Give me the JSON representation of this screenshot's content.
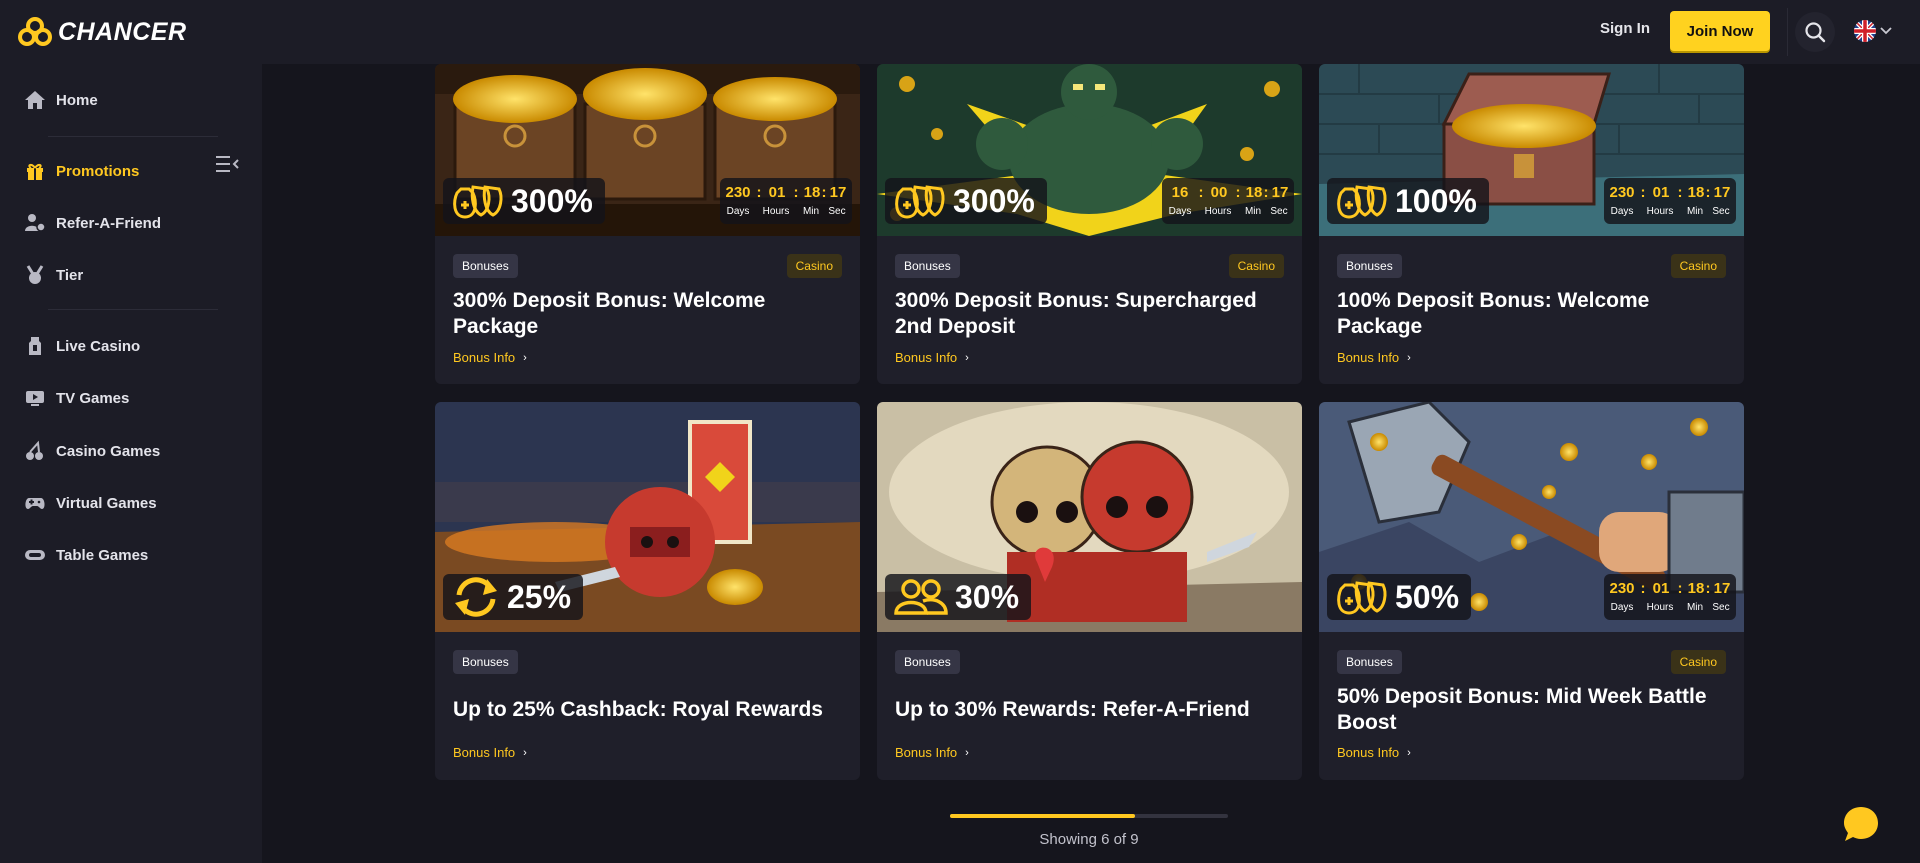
{
  "header": {
    "logo_text": "CHANCER",
    "sign_in": "Sign In",
    "join_now": "Join Now",
    "icons": [
      "logo-icon",
      "search-icon",
      "uk-flag-icon",
      "chevron-down-icon"
    ]
  },
  "sidebar": {
    "items": [
      {
        "label": "Home",
        "icon": "home-icon",
        "active": false
      },
      {
        "label": "Promotions",
        "icon": "gift-icon",
        "active": true
      },
      {
        "label": "Refer-A-Friend",
        "icon": "refer-friend-icon",
        "active": false
      },
      {
        "label": "Tier",
        "icon": "medal-icon",
        "active": false
      },
      {
        "label": "Live Casino",
        "icon": "live-casino-icon",
        "active": false
      },
      {
        "label": "TV Games",
        "icon": "tv-icon",
        "active": false
      },
      {
        "label": "Casino Games",
        "icon": "cherries-icon",
        "active": false
      },
      {
        "label": "Virtual Games",
        "icon": "gamepad-icon",
        "active": false
      },
      {
        "label": "Table Games",
        "icon": "table-games-icon",
        "active": false
      }
    ]
  },
  "timer_labels": {
    "days": "Days",
    "hours": "Hours",
    "min": "Min",
    "sec": "Sec"
  },
  "cards": [
    {
      "percent": "300%",
      "badge_icon": "money-bags-icon",
      "timer": {
        "days": "230",
        "hours": "01",
        "min": "18",
        "sec": "17"
      },
      "tag": "Bonuses",
      "category": "Casino",
      "title": "300% Deposit Bonus: Welcome Package",
      "link": "Bonus Info"
    },
    {
      "percent": "300%",
      "badge_icon": "money-bags-icon",
      "timer": {
        "days": "16",
        "hours": "00",
        "min": "18",
        "sec": "17"
      },
      "tag": "Bonuses",
      "category": "Casino",
      "title": "300% Deposit Bonus: Supercharged 2nd Deposit",
      "link": "Bonus Info"
    },
    {
      "percent": "100%",
      "badge_icon": "money-bags-icon",
      "timer": {
        "days": "230",
        "hours": "01",
        "min": "18",
        "sec": "17"
      },
      "tag": "Bonuses",
      "category": "Casino",
      "title": "100% Deposit Bonus: Welcome Package",
      "link": "Bonus Info"
    },
    {
      "percent": "25%",
      "badge_icon": "cashback-arrows-icon",
      "tag": "Bonuses",
      "title": "Up to 25% Cashback: Royal Rewards",
      "link": "Bonus Info"
    },
    {
      "percent": "30%",
      "badge_icon": "users-icon",
      "tag": "Bonuses",
      "title": "Up to 30% Rewards: Refer-A-Friend",
      "link": "Bonus Info"
    },
    {
      "percent": "50%",
      "badge_icon": "money-bags-icon",
      "timer": {
        "days": "230",
        "hours": "01",
        "min": "18",
        "sec": "17"
      },
      "tag": "Bonuses",
      "category": "Casino",
      "title": "50% Deposit Bonus: Mid Week Battle Boost",
      "link": "Bonus Info"
    }
  ],
  "pagination": {
    "text": "Showing 6 of 9",
    "progress": 0.667
  },
  "colors": {
    "accent": "#ffc820",
    "join_button": "#ffd21f",
    "background": "#15151d",
    "panel": "#1c1c26",
    "card": "#1f1f2a"
  },
  "chat_icon": "chat-bubble-icon"
}
